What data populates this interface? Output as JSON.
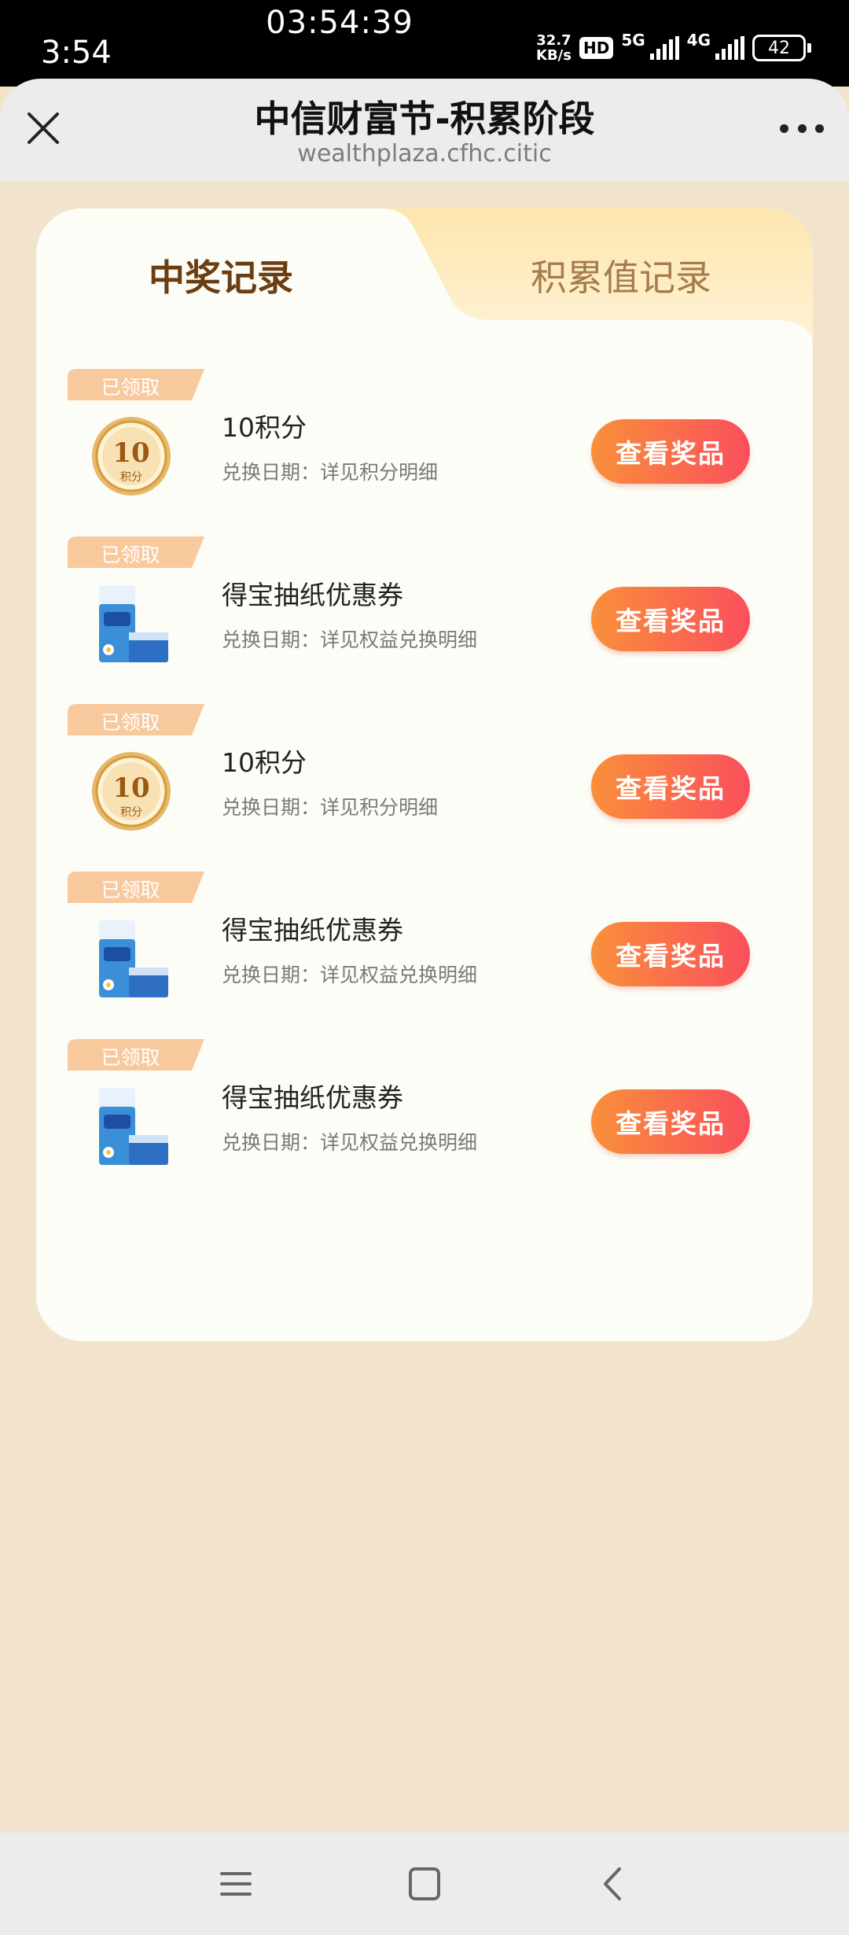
{
  "status_bar": {
    "time": "3:54",
    "clock": "03:54:39",
    "speed_value": "32.7",
    "speed_unit": "KB/s",
    "hd": "HD",
    "net_5g": "5G",
    "net_4g": "4G",
    "battery": "42"
  },
  "browser": {
    "title": "中信财富节-积累阶段",
    "url": "wealthplaza.cfhc.citic"
  },
  "tabs": [
    {
      "label": "中奖记录",
      "active": true
    },
    {
      "label": "积累值记录",
      "active": false
    }
  ],
  "items": [
    {
      "badge": "已领取",
      "icon": "points-coin-icon",
      "coin_number": "10",
      "coin_text": "积分",
      "title": "10积分",
      "subtitle": "兑换日期：详见积分明细",
      "button": "查看奖品"
    },
    {
      "badge": "已领取",
      "icon": "tissue-pack-icon",
      "title": "得宝抽纸优惠券",
      "subtitle": "兑换日期：详见权益兑换明细",
      "button": "查看奖品"
    },
    {
      "badge": "已领取",
      "icon": "points-coin-icon",
      "coin_number": "10",
      "coin_text": "积分",
      "title": "10积分",
      "subtitle": "兑换日期：详见积分明细",
      "button": "查看奖品"
    },
    {
      "badge": "已领取",
      "icon": "tissue-pack-icon",
      "title": "得宝抽纸优惠券",
      "subtitle": "兑换日期：详见权益兑换明细",
      "button": "查看奖品"
    },
    {
      "badge": "已领取",
      "icon": "tissue-pack-icon",
      "title": "得宝抽纸优惠券",
      "subtitle": "兑换日期：详见权益兑换明细",
      "button": "查看奖品"
    }
  ],
  "colors": {
    "page_bg": "#f2e4cc",
    "tab_active_text": "#6b3d10",
    "tab_inactive_text": "#a67c4d",
    "button_gradient_start": "#f9903a",
    "button_gradient_end": "#fa4f5c",
    "badge_color": "#f9c99e"
  }
}
